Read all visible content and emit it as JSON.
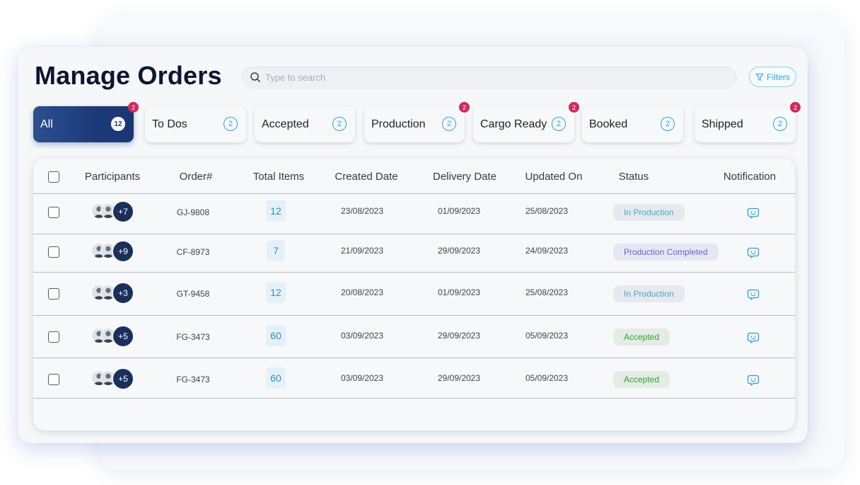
{
  "header": {
    "title": "Manage Orders",
    "search_placeholder": "Type to search",
    "filters_label": "Filters"
  },
  "tabs": [
    {
      "label": "All",
      "count": "12",
      "badge": "2",
      "active": true
    },
    {
      "label": "To Dos",
      "count": "2",
      "badge": null,
      "active": false
    },
    {
      "label": "Accepted",
      "count": "2",
      "badge": null,
      "active": false
    },
    {
      "label": "Production",
      "count": "2",
      "badge": "2",
      "active": false
    },
    {
      "label": "Cargo Ready",
      "count": "2",
      "badge": "2",
      "active": false
    },
    {
      "label": "Booked",
      "count": "2",
      "badge": null,
      "active": false
    },
    {
      "label": "Shipped",
      "count": "2",
      "badge": "2",
      "active": false
    }
  ],
  "table": {
    "columns": [
      "Participants",
      "Order#",
      "Total Items",
      "Created Date",
      "Delivery Date",
      "Updated On",
      "Status",
      "Notification"
    ],
    "rows": [
      {
        "participants_more": "+7",
        "order": "GJ-9808",
        "total_items": "12",
        "created": "23/08/2023",
        "delivery": "01/09/2023",
        "updated": "25/08/2023",
        "status": "In Production",
        "status_type": "production"
      },
      {
        "participants_more": "+9",
        "order": "CF-8973",
        "total_items": "7",
        "created": "21/09/2023",
        "delivery": "29/09/2023",
        "updated": "24/09/2023",
        "status": "Production Completed",
        "status_type": "completed"
      },
      {
        "participants_more": "+3",
        "order": "GT-9458",
        "total_items": "12",
        "created": "20/08/2023",
        "delivery": "01/09/2023",
        "updated": "25/08/2023",
        "status": "In Production",
        "status_type": "production"
      },
      {
        "participants_more": "+5",
        "order": "FG-3473",
        "total_items": "60",
        "created": "03/09/2023",
        "delivery": "29/09/2023",
        "updated": "05/09/2023",
        "status": "Accepted",
        "status_type": "accepted"
      },
      {
        "participants_more": "+5",
        "order": "FG-3473",
        "total_items": "60",
        "created": "03/09/2023",
        "delivery": "29/09/2023",
        "updated": "05/09/2023",
        "status": "Accepted",
        "status_type": "accepted"
      }
    ]
  },
  "icons": {
    "search": "search-icon",
    "filters": "filter-icon",
    "notification": "chat-bubble-icon",
    "avatar": "user-avatar"
  },
  "colors": {
    "active_tab": "#1d3a78",
    "accent": "#29a6d8",
    "badge": "#d2295a",
    "status_production": "#4aa7cd",
    "status_completed": "#6c63d6",
    "status_accepted": "#2fa13a"
  }
}
